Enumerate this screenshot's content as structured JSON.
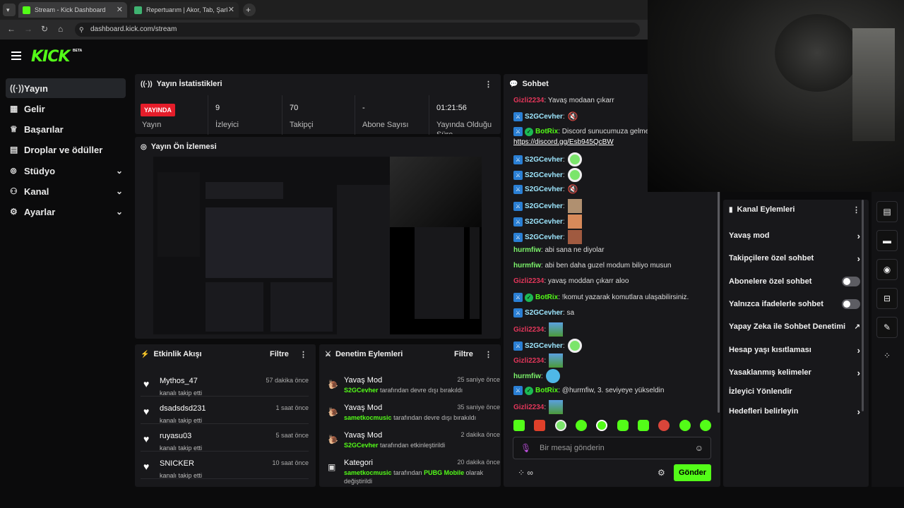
{
  "browser": {
    "tab1_title": "Stream - Kick Dashboard",
    "tab2_title": "Repertuarım | Akor, Tab, Şarkı S",
    "url": "dashboard.kick.com/stream"
  },
  "header": {
    "logo": "KICK",
    "beta": "BETA"
  },
  "sidebar": {
    "items": [
      {
        "label": "Yayın",
        "icon": "broadcast-icon"
      },
      {
        "label": "Gelir",
        "icon": "chart-icon"
      },
      {
        "label": "Başarılar",
        "icon": "trophy-icon"
      },
      {
        "label": "Droplar ve ödüller",
        "icon": "gift-icon"
      },
      {
        "label": "Stüdyo",
        "icon": "studio-icon"
      },
      {
        "label": "Kanal",
        "icon": "users-icon"
      },
      {
        "label": "Ayarlar",
        "icon": "gear-icon"
      }
    ]
  },
  "stats": {
    "title": "Yayın İstatistikleri",
    "live": "YAYINDA",
    "stream_label": "Yayın",
    "viewers": "9",
    "viewers_label": "İzleyici",
    "followers": "70",
    "followers_label": "Takipçi",
    "subs": "-",
    "subs_label": "Abone Sayısı",
    "uptime": "01:21:56",
    "uptime_label": "Yayında Olduğu Süre"
  },
  "preview": {
    "title": "Yayın Ön İzlemesi"
  },
  "activity": {
    "title": "Etkinlik Akışı",
    "filter": "Filtre",
    "items": [
      {
        "name": "Mythos_47",
        "sub": "kanalı takip etti",
        "time": "57 dakika önce"
      },
      {
        "name": "dsadsdsd231",
        "sub": "kanalı takip etti",
        "time": "1 saat önce"
      },
      {
        "name": "ruyasu03",
        "sub": "kanalı takip etti",
        "time": "5 saat önce"
      },
      {
        "name": "SNICKER",
        "sub": "kanalı takip etti",
        "time": "10 saat önce"
      }
    ]
  },
  "moderation": {
    "title": "Denetim Eylemleri",
    "filter": "Filtre",
    "items": [
      {
        "name": "Yavaş Mod",
        "user": "S2GCevher",
        "rest": "tarafından devre dışı bırakıldı",
        "time": "25 saniye önce"
      },
      {
        "name": "Yavaş Mod",
        "user": "sametkocmusic",
        "rest": "tarafından devre dışı bırakıldı",
        "time": "35 saniye önce"
      },
      {
        "name": "Yavaş Mod",
        "user": "S2GCevher",
        "rest": "tarafından etkinleştirildi",
        "time": "2 dakika önce"
      },
      {
        "name": "Kategori",
        "user": "sametkocmusic",
        "rest": "tarafından",
        "extra": "PUBG Mobile",
        "rest2": "olarak değiştirildi",
        "time": "20 dakika önce"
      }
    ]
  },
  "chat": {
    "title": "Sohbet",
    "placeholder": "Bir mesaj gönderin",
    "send": "Gönder",
    "messages": [
      {
        "user": "Gizli2234",
        "text": "Yavaş modaan çıkarr"
      },
      {
        "user": "S2GCevher",
        "text": ""
      },
      {
        "user": "BotRix",
        "text": "Discord sunucumuza gelmey"
      },
      {
        "user": "",
        "text": "https://discord.gg/Esb945QcBW"
      },
      {
        "user": "S2GCevher",
        "text": ""
      },
      {
        "user": "S2GCevher",
        "text": ""
      },
      {
        "user": "S2GCevher",
        "text": ""
      },
      {
        "user": "S2GCevher",
        "text": ""
      },
      {
        "user": "S2GCevher",
        "text": ""
      },
      {
        "user": "S2GCevher",
        "text": ""
      },
      {
        "user": "hurmfiw",
        "text": "abi sana ne diyolar"
      },
      {
        "user": "hurmfiw",
        "text": "abi ben daha guzel modum biliyo musun"
      },
      {
        "user": "Gizli2234",
        "text": "yavaş moddan çıkarr aloo"
      },
      {
        "user": "BotRix",
        "text": "!komut yazarak komutlara ulaşabilirsiniz."
      },
      {
        "user": "S2GCevher",
        "text": "sa"
      },
      {
        "user": "Gizli2234",
        "text": ""
      },
      {
        "user": "S2GCevher",
        "text": ""
      },
      {
        "user": "Gizli2234",
        "text": ""
      },
      {
        "user": "hurmfiw",
        "text": ""
      },
      {
        "user": "BotRix",
        "text": "@hurmfiw, 3. seviyeye yükseldin"
      },
      {
        "user": "Gizli2234",
        "text": ""
      }
    ]
  },
  "channel_actions": {
    "title": "Kanal Eylemleri",
    "items": [
      {
        "label": "Yavaş mod",
        "kind": "chevron"
      },
      {
        "label": "Takipçilere özel sohbet",
        "kind": "chevron"
      },
      {
        "label": "Abonelere özel sohbet",
        "kind": "toggle"
      },
      {
        "label": "Yalnızca ifadelerle sohbet",
        "kind": "toggle"
      },
      {
        "label": "Yapay Zeka ile Sohbet Denetimi",
        "kind": "external"
      },
      {
        "label": "Hesap yaşı kısıtlaması",
        "kind": "chevron"
      },
      {
        "label": "Yasaklanmış kelimeler",
        "kind": "chevron"
      },
      {
        "label": "İzleyici Yönlendir",
        "kind": "none"
      },
      {
        "label": "Hedefleri belirleyin",
        "kind": "chevron"
      }
    ]
  },
  "colors": {
    "accent": "#53fc18",
    "live": "#e51d2a",
    "bg": "#0b0b0c",
    "panel": "#18181b"
  }
}
